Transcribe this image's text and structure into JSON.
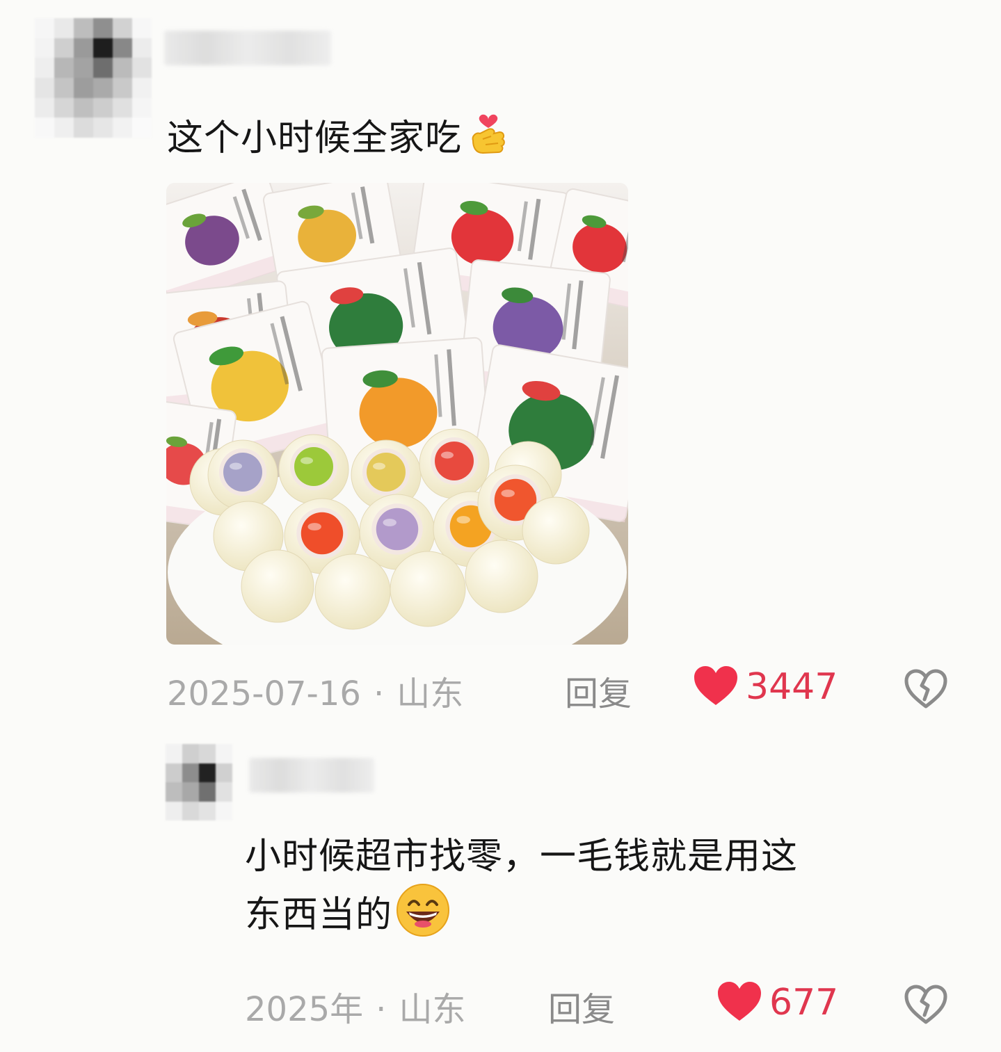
{
  "comments": [
    {
      "text": "这个小时候全家吃",
      "emoji": "finger-heart-emoji",
      "date": "2025-07-16",
      "location": "山东",
      "reply_label": "回复",
      "likes": "3447",
      "image": "fruit-milk-candy-photo"
    },
    {
      "text_line1": "小时候超市找零，一毛钱就是用这",
      "text_line2": "东西当的",
      "emoji": "grinning-face-emoji",
      "date": "2025年",
      "location": "山东",
      "reply_label": "回复",
      "likes": "677"
    }
  ],
  "separator": "·",
  "colors": {
    "like_red": "#e0364e",
    "meta_gray": "#a9a9a9",
    "reply_gray": "#8a8a8a"
  }
}
